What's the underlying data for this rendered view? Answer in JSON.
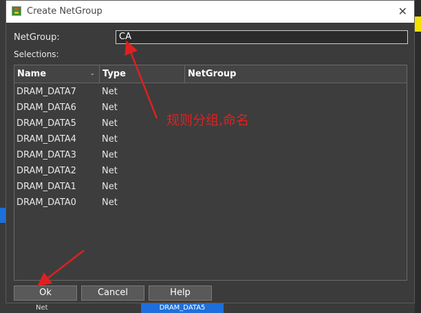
{
  "dialog": {
    "title": "Create NetGroup",
    "netgroup_label": "NetGroup:",
    "netgroup_value": "CA",
    "selections_label": "Selections:"
  },
  "table": {
    "columns": [
      "Name",
      "Type",
      "NetGroup"
    ],
    "rows": [
      {
        "name": "DRAM_DATA7",
        "type": "Net",
        "netgroup": ""
      },
      {
        "name": "DRAM_DATA6",
        "type": "Net",
        "netgroup": ""
      },
      {
        "name": "DRAM_DATA5",
        "type": "Net",
        "netgroup": ""
      },
      {
        "name": "DRAM_DATA4",
        "type": "Net",
        "netgroup": ""
      },
      {
        "name": "DRAM_DATA3",
        "type": "Net",
        "netgroup": ""
      },
      {
        "name": "DRAM_DATA2",
        "type": "Net",
        "netgroup": ""
      },
      {
        "name": "DRAM_DATA1",
        "type": "Net",
        "netgroup": ""
      },
      {
        "name": "DRAM_DATA0",
        "type": "Net",
        "netgroup": ""
      }
    ]
  },
  "buttons": {
    "ok": "Ok",
    "cancel": "Cancel",
    "help": "Help"
  },
  "annotation": {
    "text": "规则分组,命名",
    "color": "#e02020"
  },
  "background": {
    "bottom_tab": "DRAM_DATA5",
    "bottom_cell": "Net"
  },
  "icons": {
    "app": "netgroup-app-icon",
    "close": "close-icon",
    "sort": "chevron-down-icon"
  }
}
